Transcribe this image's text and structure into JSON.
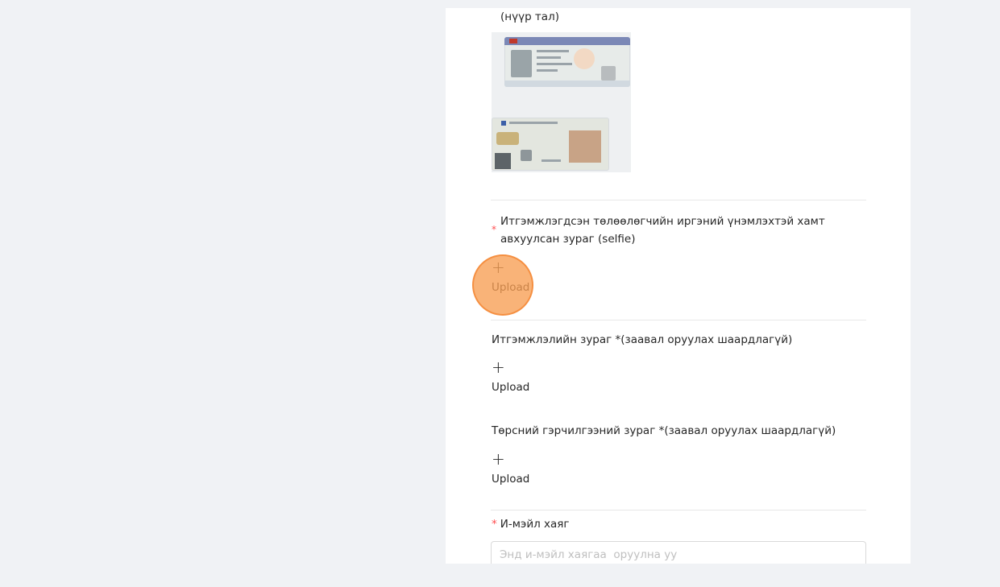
{
  "form": {
    "front_side_caption": "(нүүр тал)",
    "selfie": {
      "required_mark": "*",
      "label": "Итгэмжлэгдсэн төлөөлөгчийн иргэний үнэмлэхтэй хамт авхуулсан зураг (selfie)",
      "upload_plus": "+",
      "upload_label": "Upload"
    },
    "proxy_photo": {
      "label": "Итгэмжлэлийн зураг *(заавал оруулах шаардлагүй)",
      "upload_plus": "+",
      "upload_label": "Upload"
    },
    "birth_cert": {
      "label": "Төрсний гэрчилгээний зураг *(заавал оруулах шаардлагүй)",
      "upload_plus": "+",
      "upload_label": "Upload"
    },
    "email": {
      "required_mark": "*",
      "label": "И-мэйл хаяг",
      "placeholder": "Энд и-мэйл хаягаа  оруулна уу",
      "value": ""
    }
  },
  "colors": {
    "page_bg": "#f0f2f5",
    "card_bg": "#ffffff",
    "required": "#ff4d4f",
    "click_highlight": "#f79d52"
  }
}
